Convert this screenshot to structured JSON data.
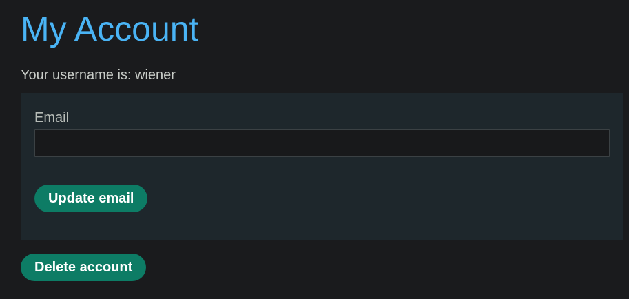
{
  "header": {
    "title": "My Account"
  },
  "account": {
    "username_text": "Your username is: wiener"
  },
  "email_form": {
    "label": "Email",
    "value": "",
    "placeholder": "",
    "submit_label": "Update email"
  },
  "actions": {
    "delete_label": "Delete account"
  },
  "colors": {
    "background": "#1a1b1d",
    "panel": "#1e272c",
    "title": "#4ab4f5",
    "button": "#0d7c65"
  }
}
